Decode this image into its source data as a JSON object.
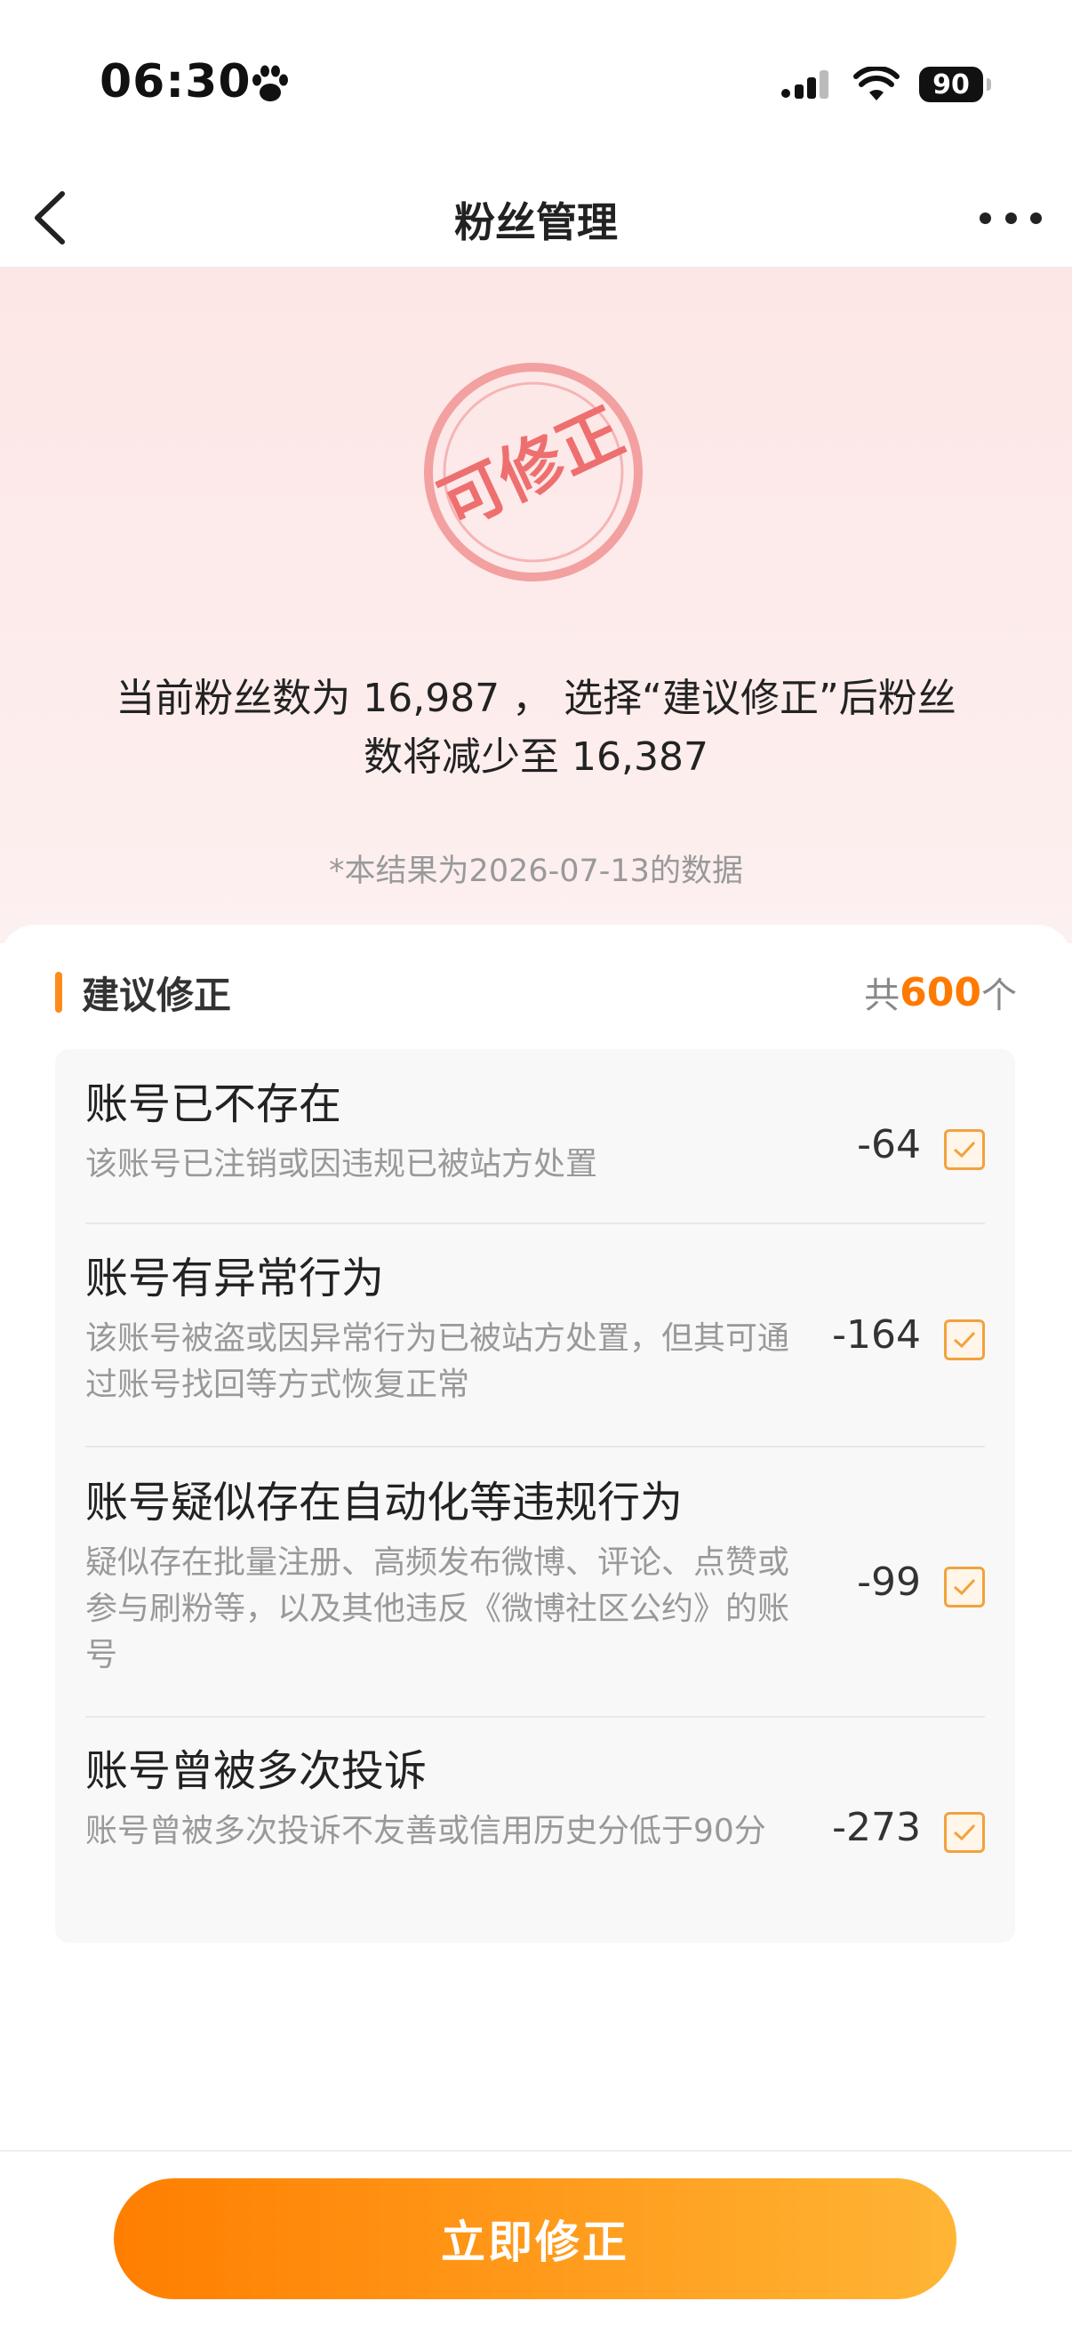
{
  "status_bar": {
    "time": "06:30",
    "battery": "90"
  },
  "nav": {
    "title": "粉丝管理"
  },
  "hero": {
    "stamp_text": "可修正",
    "summary_line1": "当前粉丝数为 16,987 ， 选择“建议修正”后粉丝",
    "summary_line2": "数将减少至 16,387",
    "note": "*本结果为2026-07-13的数据"
  },
  "section": {
    "title": "建议修正",
    "count_prefix": "共",
    "count_value": "600",
    "count_suffix": "个"
  },
  "items": [
    {
      "title": "账号已不存在",
      "desc": "该账号已注销或因违规已被站方处置",
      "value": "-64",
      "checked": true
    },
    {
      "title": "账号有异常行为",
      "desc": "该账号被盗或因异常行为已被站方处置，但其可通过账号找回等方式恢复正常",
      "value": "-164",
      "checked": true
    },
    {
      "title": "账号疑似存在自动化等违规行为",
      "desc": "疑似存在批量注册、高频发布微博、评论、点赞或参与刷粉等，以及其他违反《微博社区公约》的账号",
      "value": "-99",
      "checked": true
    },
    {
      "title": "账号曾被多次投诉",
      "desc": "账号曾被多次投诉不友善或信用历史分低于90分",
      "value": "-273",
      "checked": true
    }
  ],
  "footer": {
    "button_label": "立即修正"
  },
  "colors": {
    "accent": "#ff7a00",
    "check": "#f2a23d",
    "stamp": "#f07575"
  }
}
